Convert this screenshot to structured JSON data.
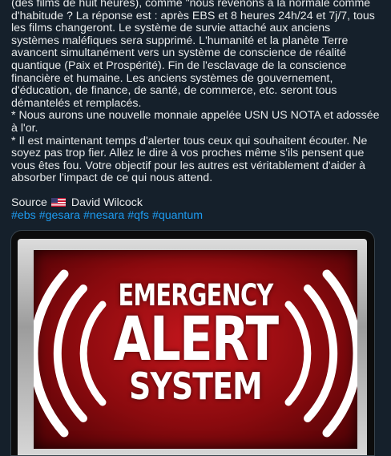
{
  "post": {
    "paragraphs": [
      "(des films de huit heures), comme \"nous revenons à la normale comme d'habitude ? La réponse est : après EBS et 8 heures 24h/24 et 7j/7, tous les films changeront. Le système de survie attaché aux anciens systèmes maléfiques sera supprimé. L'humanité et la planète Terre avancent simultanément vers un système de conscience de réalité quantique (Paix et Prospérité). Fin de l'esclavage de la conscience financière et humaine. Les anciens systèmes de gouvernement, d'éducation, de finance, de santé, de commerce, etc. seront tous démantelés et remplacés.",
      "* Nous aurons une nouvelle monnaie appelée USN US NOTA et adossée à l'or.",
      "* Il est maintenant temps d'alerter tous ceux qui souhaitent écouter. Ne soyez pas trop fier. Allez le dire à vos proches même s'ils pensent que vous êtes fou. Votre objectif pour les autres est véritablement d'aider à absorber l'impact de ce qui nous attend."
    ],
    "source_label": "Source",
    "source_flag": "us-flag-icon",
    "source_name": "David Wilcock",
    "hashtags": [
      "#ebs",
      "#gesara",
      "#nesara",
      "#qfs",
      "#quantum"
    ]
  },
  "media": {
    "alert_line1": "EMERGENCY",
    "alert_line2": "ALERT",
    "alert_line3": "SYSTEM",
    "colors": {
      "panel_red": "#c3161c",
      "hashtag_blue": "#1d9bf0",
      "background": "#15202b"
    }
  }
}
